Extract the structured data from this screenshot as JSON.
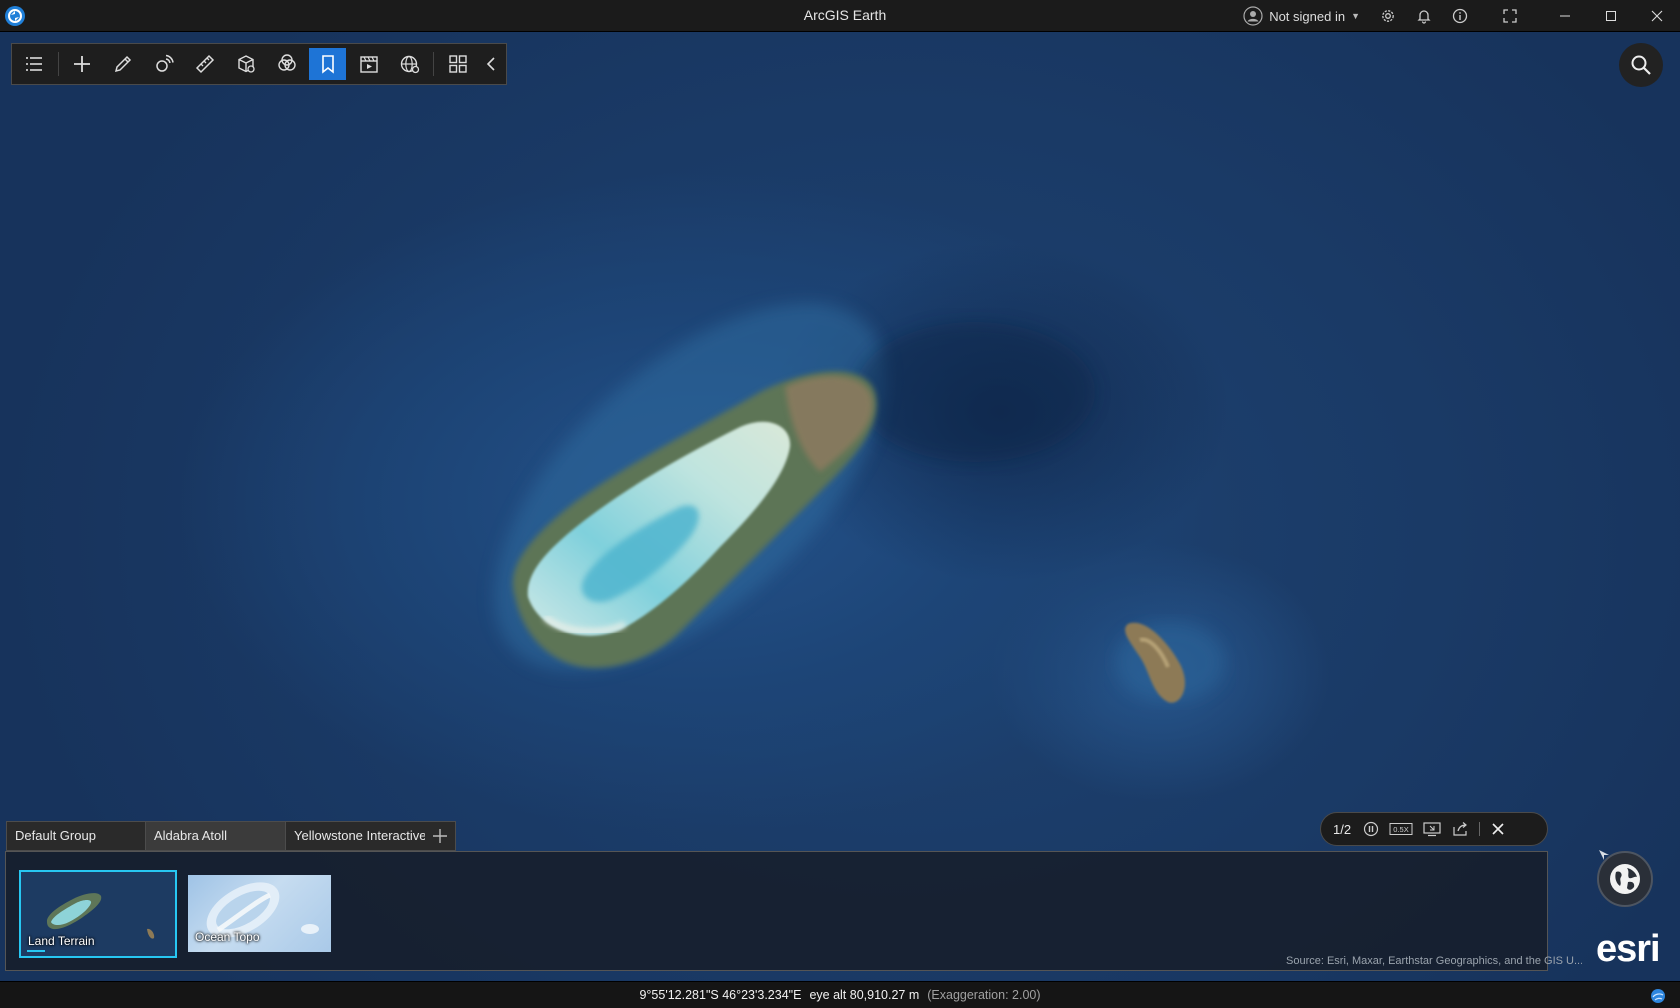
{
  "window": {
    "title": "ArcGIS Earth",
    "user_status": "Not signed in"
  },
  "toolbar": {
    "tools": [
      {
        "icon": "layers-list-icon",
        "active": false
      },
      {
        "icon": "add-icon",
        "active": false
      },
      {
        "icon": "draw-pencil-icon",
        "active": false
      },
      {
        "icon": "interactive-analysis-icon",
        "active": false
      },
      {
        "icon": "measure-ruler-icon",
        "active": false
      },
      {
        "icon": "3d-analysis-icon",
        "active": false
      },
      {
        "icon": "overlay-circles-icon",
        "active": false
      },
      {
        "icon": "bookmark-icon",
        "active": true
      },
      {
        "icon": "tour-clapperboard-icon",
        "active": false
      },
      {
        "icon": "globe-settings-icon",
        "active": false
      },
      {
        "icon": "more-grid-icon",
        "active": false
      },
      {
        "icon": "collapse-chevron-icon",
        "active": false
      }
    ],
    "active_color": "#1e74d6"
  },
  "bookmarks": {
    "tabs": [
      "Default Group",
      "Aldabra Atoll",
      "Yellowstone Interactive"
    ],
    "selected_tab": "Aldabra Atoll",
    "items": [
      {
        "label": "Land Terrain",
        "selected": true
      },
      {
        "label": "Ocean Topo",
        "selected": false
      }
    ]
  },
  "player": {
    "counter": "1/2",
    "speed": "0.5X"
  },
  "map": {
    "attribution": "Source: Esri, Maxar, Earthstar Geographics, and the GIS U...",
    "logo": "esri"
  },
  "status": {
    "coordinates": "9°55'12.281\"S 46°23'3.234\"E",
    "eye_alt": "eye alt 80,910.27 m",
    "exaggeration": "(Exaggeration: 2.00)"
  },
  "colors": {
    "accent": "#1e74d6",
    "selection": "#27c7f2",
    "ocean": "#1d4577"
  }
}
